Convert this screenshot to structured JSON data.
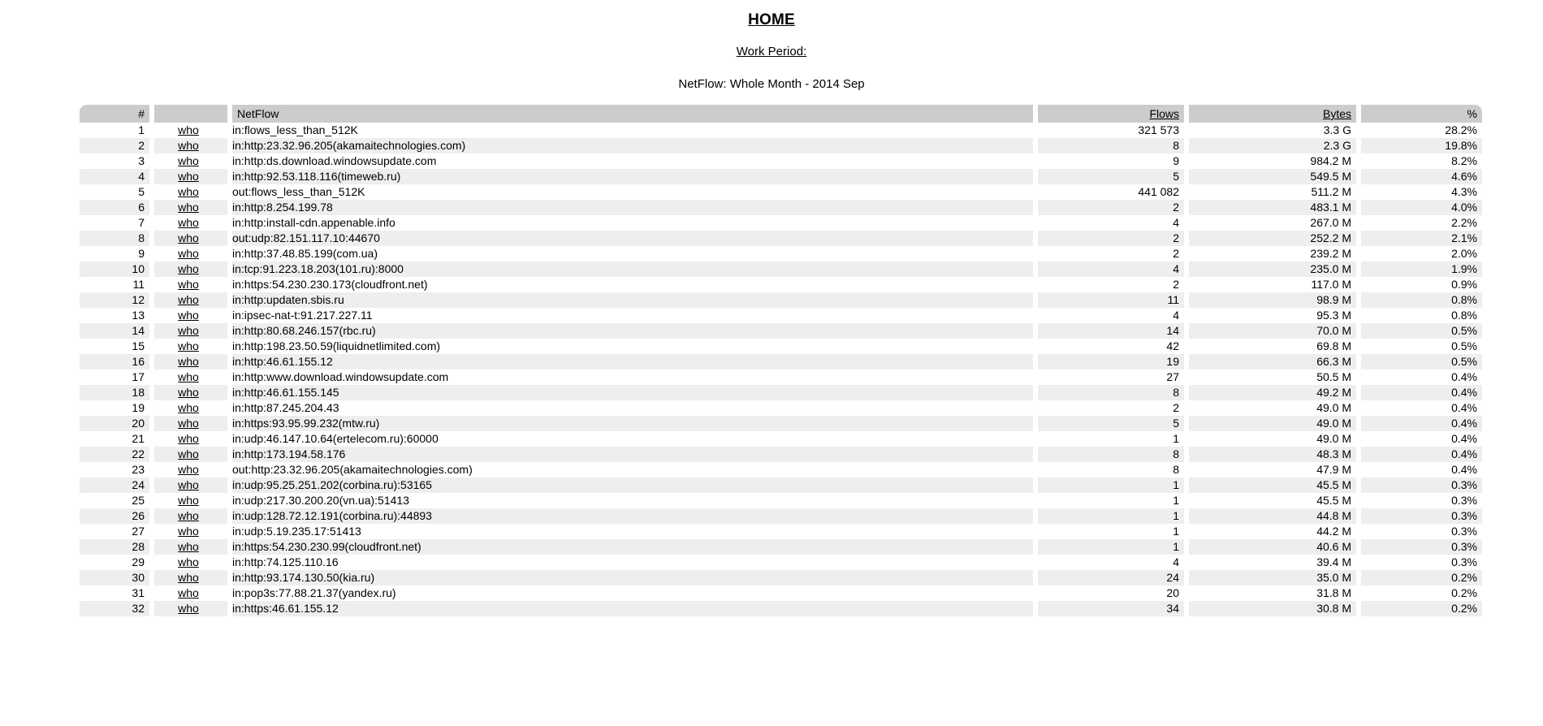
{
  "header": {
    "title": "HOME",
    "work_period_label": "Work Period:",
    "report_subtitle": "NetFlow: Whole Month - 2014 Sep"
  },
  "table": {
    "columns": {
      "rank": "#",
      "who": "",
      "netflow": "NetFlow",
      "flows": "Flows",
      "bytes": "Bytes",
      "percent": "%"
    },
    "who_link_label": "who",
    "rows": [
      {
        "rank": "1",
        "who": "who",
        "netflow": "in:flows_less_than_512K",
        "flows": "321 573",
        "bytes": "3.3 G",
        "percent": "28.2%"
      },
      {
        "rank": "2",
        "who": "who",
        "netflow": "in:http:23.32.96.205(akamaitechnologies.com)",
        "flows": "8",
        "bytes": "2.3 G",
        "percent": "19.8%"
      },
      {
        "rank": "3",
        "who": "who",
        "netflow": "in:http:ds.download.windowsupdate.com",
        "flows": "9",
        "bytes": "984.2 M",
        "percent": "8.2%"
      },
      {
        "rank": "4",
        "who": "who",
        "netflow": "in:http:92.53.118.116(timeweb.ru)",
        "flows": "5",
        "bytes": "549.5 M",
        "percent": "4.6%"
      },
      {
        "rank": "5",
        "who": "who",
        "netflow": "out:flows_less_than_512K",
        "flows": "441 082",
        "bytes": "511.2 M",
        "percent": "4.3%"
      },
      {
        "rank": "6",
        "who": "who",
        "netflow": "in:http:8.254.199.78",
        "flows": "2",
        "bytes": "483.1 M",
        "percent": "4.0%"
      },
      {
        "rank": "7",
        "who": "who",
        "netflow": "in:http:install-cdn.appenable.info",
        "flows": "4",
        "bytes": "267.0 M",
        "percent": "2.2%"
      },
      {
        "rank": "8",
        "who": "who",
        "netflow": "out:udp:82.151.117.10:44670",
        "flows": "2",
        "bytes": "252.2 M",
        "percent": "2.1%"
      },
      {
        "rank": "9",
        "who": "who",
        "netflow": "in:http:37.48.85.199(com.ua)",
        "flows": "2",
        "bytes": "239.2 M",
        "percent": "2.0%"
      },
      {
        "rank": "10",
        "who": "who",
        "netflow": "in:tcp:91.223.18.203(101.ru):8000",
        "flows": "4",
        "bytes": "235.0 M",
        "percent": "1.9%"
      },
      {
        "rank": "11",
        "who": "who",
        "netflow": "in:https:54.230.230.173(cloudfront.net)",
        "flows": "2",
        "bytes": "117.0 M",
        "percent": "0.9%"
      },
      {
        "rank": "12",
        "who": "who",
        "netflow": "in:http:updaten.sbis.ru",
        "flows": "11",
        "bytes": "98.9 M",
        "percent": "0.8%"
      },
      {
        "rank": "13",
        "who": "who",
        "netflow": "in:ipsec-nat-t:91.217.227.11",
        "flows": "4",
        "bytes": "95.3 M",
        "percent": "0.8%"
      },
      {
        "rank": "14",
        "who": "who",
        "netflow": "in:http:80.68.246.157(rbc.ru)",
        "flows": "14",
        "bytes": "70.0 M",
        "percent": "0.5%"
      },
      {
        "rank": "15",
        "who": "who",
        "netflow": "in:http:198.23.50.59(liquidnetlimited.com)",
        "flows": "42",
        "bytes": "69.8 M",
        "percent": "0.5%"
      },
      {
        "rank": "16",
        "who": "who",
        "netflow": "in:http:46.61.155.12",
        "flows": "19",
        "bytes": "66.3 M",
        "percent": "0.5%"
      },
      {
        "rank": "17",
        "who": "who",
        "netflow": "in:http:www.download.windowsupdate.com",
        "flows": "27",
        "bytes": "50.5 M",
        "percent": "0.4%"
      },
      {
        "rank": "18",
        "who": "who",
        "netflow": "in:http:46.61.155.145",
        "flows": "8",
        "bytes": "49.2 M",
        "percent": "0.4%"
      },
      {
        "rank": "19",
        "who": "who",
        "netflow": "in:http:87.245.204.43",
        "flows": "2",
        "bytes": "49.0 M",
        "percent": "0.4%"
      },
      {
        "rank": "20",
        "who": "who",
        "netflow": "in:https:93.95.99.232(mtw.ru)",
        "flows": "5",
        "bytes": "49.0 M",
        "percent": "0.4%"
      },
      {
        "rank": "21",
        "who": "who",
        "netflow": "in:udp:46.147.10.64(ertelecom.ru):60000",
        "flows": "1",
        "bytes": "49.0 M",
        "percent": "0.4%"
      },
      {
        "rank": "22",
        "who": "who",
        "netflow": "in:http:173.194.58.176",
        "flows": "8",
        "bytes": "48.3 M",
        "percent": "0.4%"
      },
      {
        "rank": "23",
        "who": "who",
        "netflow": "out:http:23.32.96.205(akamaitechnologies.com)",
        "flows": "8",
        "bytes": "47.9 M",
        "percent": "0.4%"
      },
      {
        "rank": "24",
        "who": "who",
        "netflow": "in:udp:95.25.251.202(corbina.ru):53165",
        "flows": "1",
        "bytes": "45.5 M",
        "percent": "0.3%"
      },
      {
        "rank": "25",
        "who": "who",
        "netflow": "in:udp:217.30.200.20(vn.ua):51413",
        "flows": "1",
        "bytes": "45.5 M",
        "percent": "0.3%"
      },
      {
        "rank": "26",
        "who": "who",
        "netflow": "in:udp:128.72.12.191(corbina.ru):44893",
        "flows": "1",
        "bytes": "44.8 M",
        "percent": "0.3%"
      },
      {
        "rank": "27",
        "who": "who",
        "netflow": "in:udp:5.19.235.17:51413",
        "flows": "1",
        "bytes": "44.2 M",
        "percent": "0.3%"
      },
      {
        "rank": "28",
        "who": "who",
        "netflow": "in:https:54.230.230.99(cloudfront.net)",
        "flows": "1",
        "bytes": "40.6 M",
        "percent": "0.3%"
      },
      {
        "rank": "29",
        "who": "who",
        "netflow": "in:http:74.125.110.16",
        "flows": "4",
        "bytes": "39.4 M",
        "percent": "0.3%"
      },
      {
        "rank": "30",
        "who": "who",
        "netflow": "in:http:93.174.130.50(kia.ru)",
        "flows": "24",
        "bytes": "35.0 M",
        "percent": "0.2%"
      },
      {
        "rank": "31",
        "who": "who",
        "netflow": "in:pop3s:77.88.21.37(yandex.ru)",
        "flows": "20",
        "bytes": "31.8 M",
        "percent": "0.2%"
      },
      {
        "rank": "32",
        "who": "who",
        "netflow": "in:https:46.61.155.12",
        "flows": "34",
        "bytes": "30.8 M",
        "percent": "0.2%"
      }
    ]
  },
  "colors": {
    "header_band": "#cccccc",
    "row_alt": "#eeeeee",
    "row_plain": "#ffffff",
    "text": "#000000"
  }
}
